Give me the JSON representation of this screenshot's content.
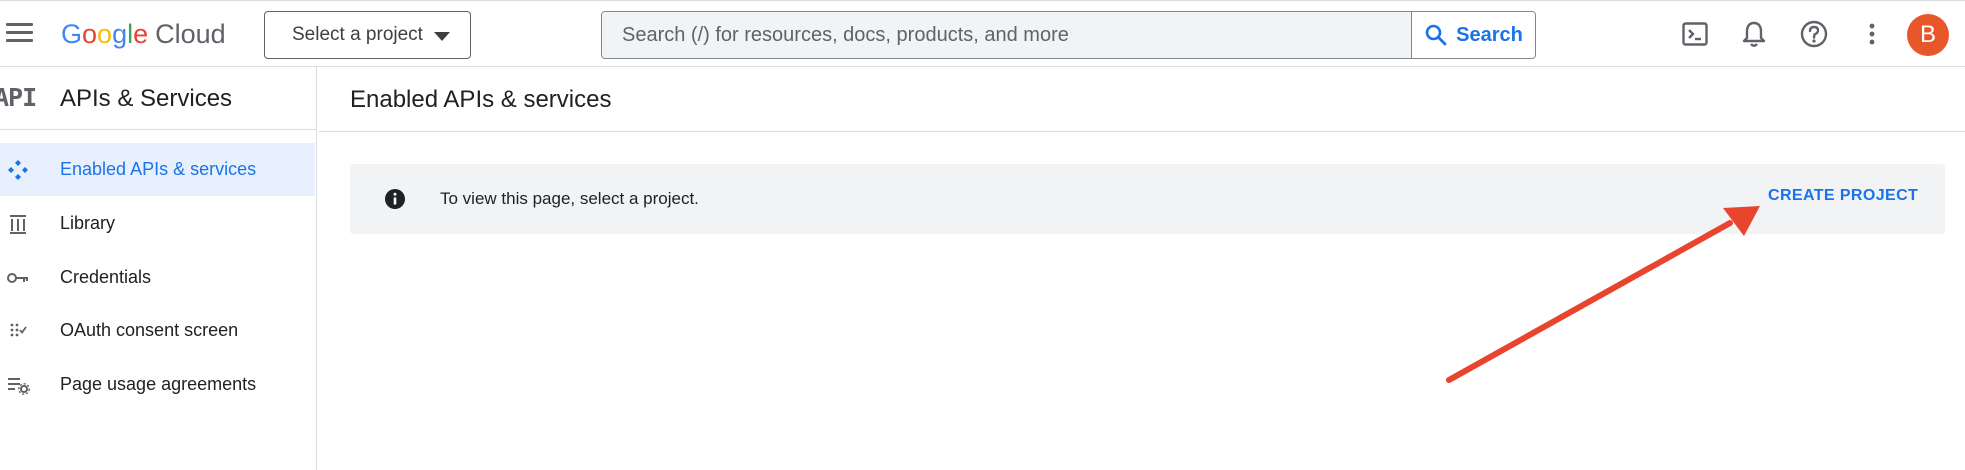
{
  "topbar": {
    "brand": {
      "letters": [
        "G",
        "o",
        "o",
        "g",
        "l",
        "e"
      ],
      "product": "Cloud"
    },
    "project_picker": {
      "label": "Select a project"
    },
    "search": {
      "placeholder": "Search (/) for resources, docs, products, and more",
      "button_label": "Search"
    },
    "icons": [
      "cloud-shell-icon",
      "notifications-icon",
      "help-icon",
      "more-vert-icon"
    ],
    "avatar_initial": "B",
    "avatar_color": "#e8572a"
  },
  "sidebar": {
    "title": "APIs & Services",
    "header_icon_text": "API",
    "items": [
      {
        "label": "Enabled APIs & services",
        "icon": "enabled-apis-icon",
        "active": true
      },
      {
        "label": "Library",
        "icon": "library-icon",
        "active": false
      },
      {
        "label": "Credentials",
        "icon": "key-icon",
        "active": false
      },
      {
        "label": "OAuth consent screen",
        "icon": "oauth-consent-icon",
        "active": false
      },
      {
        "label": "Page usage agreements",
        "icon": "page-usage-settings-icon",
        "active": false
      }
    ]
  },
  "main": {
    "title": "Enabled APIs & services",
    "banner": {
      "icon": "info-icon",
      "message": "To view this page, select a project.",
      "action_label": "CREATE PROJECT"
    }
  },
  "annotation": {
    "type": "arrow",
    "color": "#e8442e",
    "points_to": "create-project-link"
  },
  "colors": {
    "accent": "#1a73e8",
    "active_nav_bg": "#e8f0fe",
    "banner_bg": "#f1f3f4",
    "divider": "#dadce0"
  }
}
